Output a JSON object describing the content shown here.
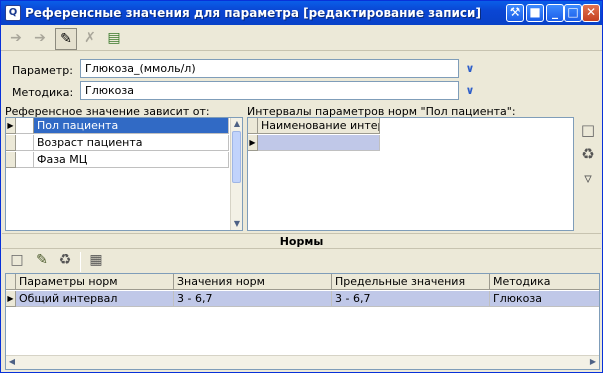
{
  "window": {
    "title": "Референсные значения для параметра [редактирование записи]",
    "app_icon_glyph": "Q"
  },
  "toolbar": {
    "back_icon": "arrow-left",
    "forward_icon": "arrow-right",
    "edit_icon": "pencil",
    "delete_icon": "cross",
    "exit_icon": "door-exit"
  },
  "form": {
    "param_label": "Параметр:",
    "param_value": "Глюкоза_(ммоль/л)",
    "method_label": "Методика:",
    "method_value": "Глюкоза"
  },
  "depends": {
    "title": "Референсное значение зависит от:",
    "rows": [
      "Пол пациента",
      "Возраст пациента",
      "Фаза МЦ"
    ],
    "selected_index": 0
  },
  "intervals": {
    "title": "Интервалы параметров норм \"Пол пациента\":",
    "column": "Наименование интервала",
    "rows": [
      ""
    ]
  },
  "norms": {
    "band_title": "Нормы",
    "columns": [
      "Параметры норм",
      "Значения норм",
      "Предельные значения",
      "Методика"
    ],
    "rows": [
      [
        "Общий интервал",
        "3 - 6,7",
        "3 - 6,7",
        "Глюкоза"
      ]
    ]
  },
  "colors": {
    "title_bar": "#0A46D4",
    "selection": "#316AC5",
    "selected_row": "#C0C8E8",
    "dialog_bg": "#ECE9D8"
  }
}
